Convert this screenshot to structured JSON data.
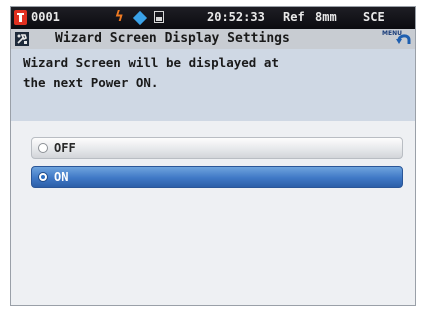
{
  "status_bar": {
    "sample_number": "0001",
    "time": "20:52:33",
    "mode_ref": "Ref",
    "aperture": "8mm",
    "specular": "SCE"
  },
  "title_bar": {
    "title": "Wizard Screen Display Settings",
    "menu_label": "MENU"
  },
  "message": {
    "line1": "Wizard Screen will be displayed at",
    "line2": "the next Power ON."
  },
  "options": [
    {
      "label": "OFF",
      "selected": false
    },
    {
      "label": "ON",
      "selected": true
    }
  ],
  "colors": {
    "status_bg": "#0b0b10",
    "title_bg": "#c8ccd2",
    "message_bg": "#cfd8e4",
    "selected_option": "#3f78c6",
    "alert_icon": "#e03020"
  }
}
